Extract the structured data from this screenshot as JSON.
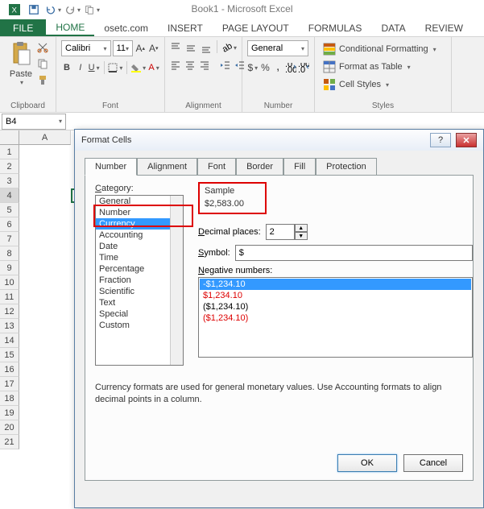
{
  "title": "Book1 - Microsoft Excel",
  "tabs": {
    "file": "FILE",
    "home": "HOME",
    "osetc": "osetc.com",
    "insert": "INSERT",
    "page": "PAGE LAYOUT",
    "formulas": "FORMULAS",
    "data": "DATA",
    "review": "REVIEW"
  },
  "clipboard": {
    "paste": "Paste",
    "label": "Clipboard"
  },
  "font": {
    "name": "Calibri",
    "size": "11",
    "label": "Font"
  },
  "align": {
    "label": "Alignment"
  },
  "number": {
    "format": "General",
    "label": "Number"
  },
  "styles": {
    "cond": "Conditional Formatting",
    "table": "Format as Table",
    "cell": "Cell Styles",
    "label": "Styles"
  },
  "namebox": "B4",
  "cols": [
    "A"
  ],
  "rows": [
    "1",
    "2",
    "3",
    "4",
    "5",
    "6",
    "7",
    "8",
    "9",
    "10",
    "11",
    "12",
    "13",
    "14",
    "15",
    "16",
    "17",
    "18",
    "19",
    "20",
    "21"
  ],
  "dialog": {
    "title": "Format Cells",
    "tabs": {
      "number": "Number",
      "alignment": "Alignment",
      "font": "Font",
      "border": "Border",
      "fill": "Fill",
      "protection": "Protection"
    },
    "category_label": "Category:",
    "categories": [
      "General",
      "Number",
      "Currency",
      "Accounting",
      "Date",
      "Time",
      "Percentage",
      "Fraction",
      "Scientific",
      "Text",
      "Special",
      "Custom"
    ],
    "selected_category": "Currency",
    "sample_label": "Sample",
    "sample_value": "$2,583.00",
    "decimal_label": "Decimal places:",
    "decimal_value": "2",
    "symbol_label": "Symbol:",
    "symbol_value": "$",
    "negative_label": "Negative numbers:",
    "negatives": [
      "-$1,234.10",
      "$1,234.10",
      "($1,234.10)",
      "($1,234.10)"
    ],
    "description": "Currency formats are used for general monetary values.  Use Accounting formats to align decimal points in a column.",
    "ok": "OK",
    "cancel": "Cancel",
    "help": "?"
  }
}
